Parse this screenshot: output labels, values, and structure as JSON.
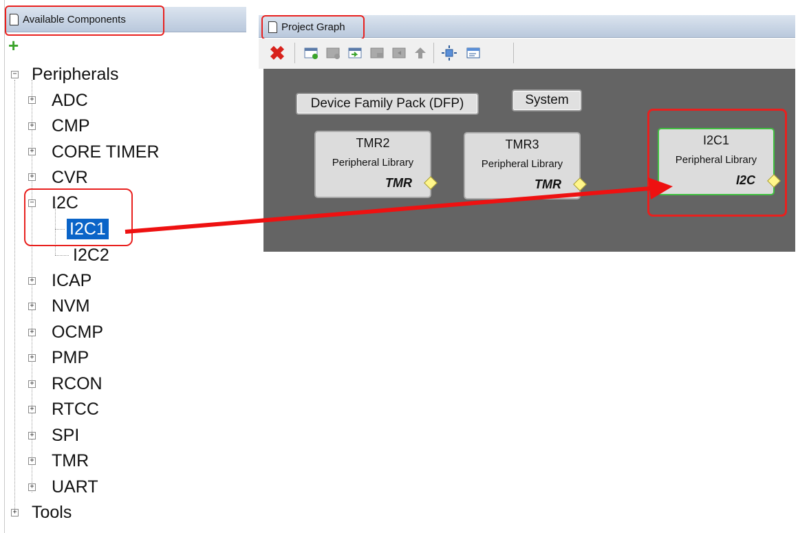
{
  "available_components": {
    "title": "Available Components",
    "add_icon": "plus-icon",
    "tree": {
      "root": "Peripherals",
      "children": [
        {
          "label": "ADC"
        },
        {
          "label": "CMP"
        },
        {
          "label": "CORE TIMER"
        },
        {
          "label": "CVR"
        },
        {
          "label": "I2C",
          "expanded": true,
          "children": [
            {
              "label": "I2C1",
              "selected": true
            },
            {
              "label": "I2C2"
            }
          ]
        },
        {
          "label": "ICAP"
        },
        {
          "label": "NVM"
        },
        {
          "label": "OCMP"
        },
        {
          "label": "PMP"
        },
        {
          "label": "RCON"
        },
        {
          "label": "RTCC"
        },
        {
          "label": "SPI"
        },
        {
          "label": "TMR"
        },
        {
          "label": "UART"
        }
      ],
      "tools": "Tools"
    }
  },
  "project_graph": {
    "title": "Project Graph",
    "toolbar_icons": [
      "delete-icon",
      "add-group-icon",
      "remove-group-icon",
      "import-icon",
      "export-icon",
      "move-out-icon",
      "move-up-icon",
      "fit-view-icon",
      "properties-icon"
    ],
    "pills": {
      "dfp": "Device Family Pack (DFP)",
      "system": "System"
    },
    "nodes": [
      {
        "title": "TMR2",
        "subtitle": "Peripheral Library",
        "type": "TMR"
      },
      {
        "title": "TMR3",
        "subtitle": "Peripheral Library",
        "type": "TMR"
      },
      {
        "title": "I2C1",
        "subtitle": "Peripheral Library",
        "type": "I2C"
      }
    ]
  },
  "colors": {
    "highlight": "#e8201e",
    "selection": "#0a64c8",
    "canvas": "#646464",
    "active_node_border": "#3fbf3f"
  }
}
